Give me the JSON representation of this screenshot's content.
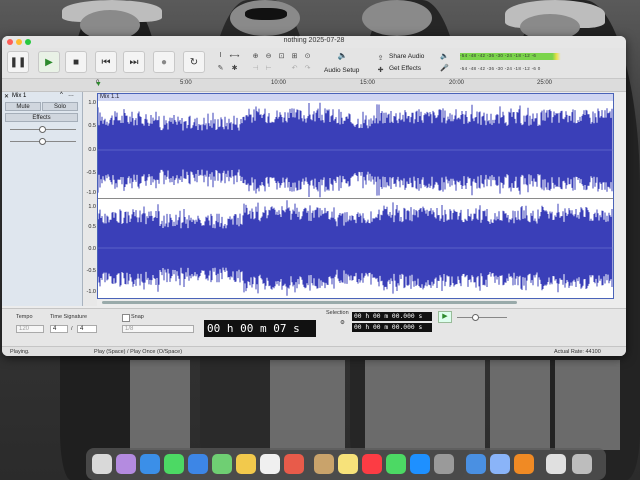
{
  "window": {
    "title": "nothing 2025-07-28"
  },
  "toolbar": {
    "audio_setup_label": "Audio Setup",
    "share_audio_label": "Share Audio",
    "get_effects_label": "Get Effects",
    "meter_scale_top": "-54 -48 -42 -36 -30 -24 -18 -12 -6",
    "meter_scale_bottom": "-54 -48 -42 -36 -30 -24 -18 -12 -6 0"
  },
  "ruler": {
    "ticks": [
      "0",
      "5:00",
      "10:00",
      "15:00",
      "20:00",
      "25:00"
    ]
  },
  "track": {
    "name": "Mix 1",
    "mute_label": "Mute",
    "solo_label": "Solo",
    "effects_label": "Effects",
    "clip_name": "Mix 1.1",
    "scale_top": [
      "1.0",
      "0.5",
      "0.0",
      "-0.5",
      "-1.0"
    ],
    "scale_bottom": [
      "1.0",
      "0.5",
      "0.0",
      "-0.5",
      "-1.0"
    ]
  },
  "bottom": {
    "tempo_label": "Tempo",
    "tempo_value": "120",
    "time_sig_label": "Time Signature",
    "time_sig_num": "4",
    "time_sig_slash": "/",
    "time_sig_den": "4",
    "snap_label": "Snap",
    "snap_value": "1/8",
    "time_display": "00 h 00 m 07 s",
    "selection_label": "Selection",
    "selection_start": "00 h 00 m 00.000 s",
    "selection_end": "00 h 00 m 00.000 s"
  },
  "status": {
    "left": "Playing.",
    "middle": "Play (Space) / Play Once (O/Space)",
    "right": "Actual Rate: 44100"
  },
  "colors": {
    "waveform": "#3a3fb8",
    "clip_header": "#cfd5f2",
    "meter_green": "#7bd44b"
  }
}
